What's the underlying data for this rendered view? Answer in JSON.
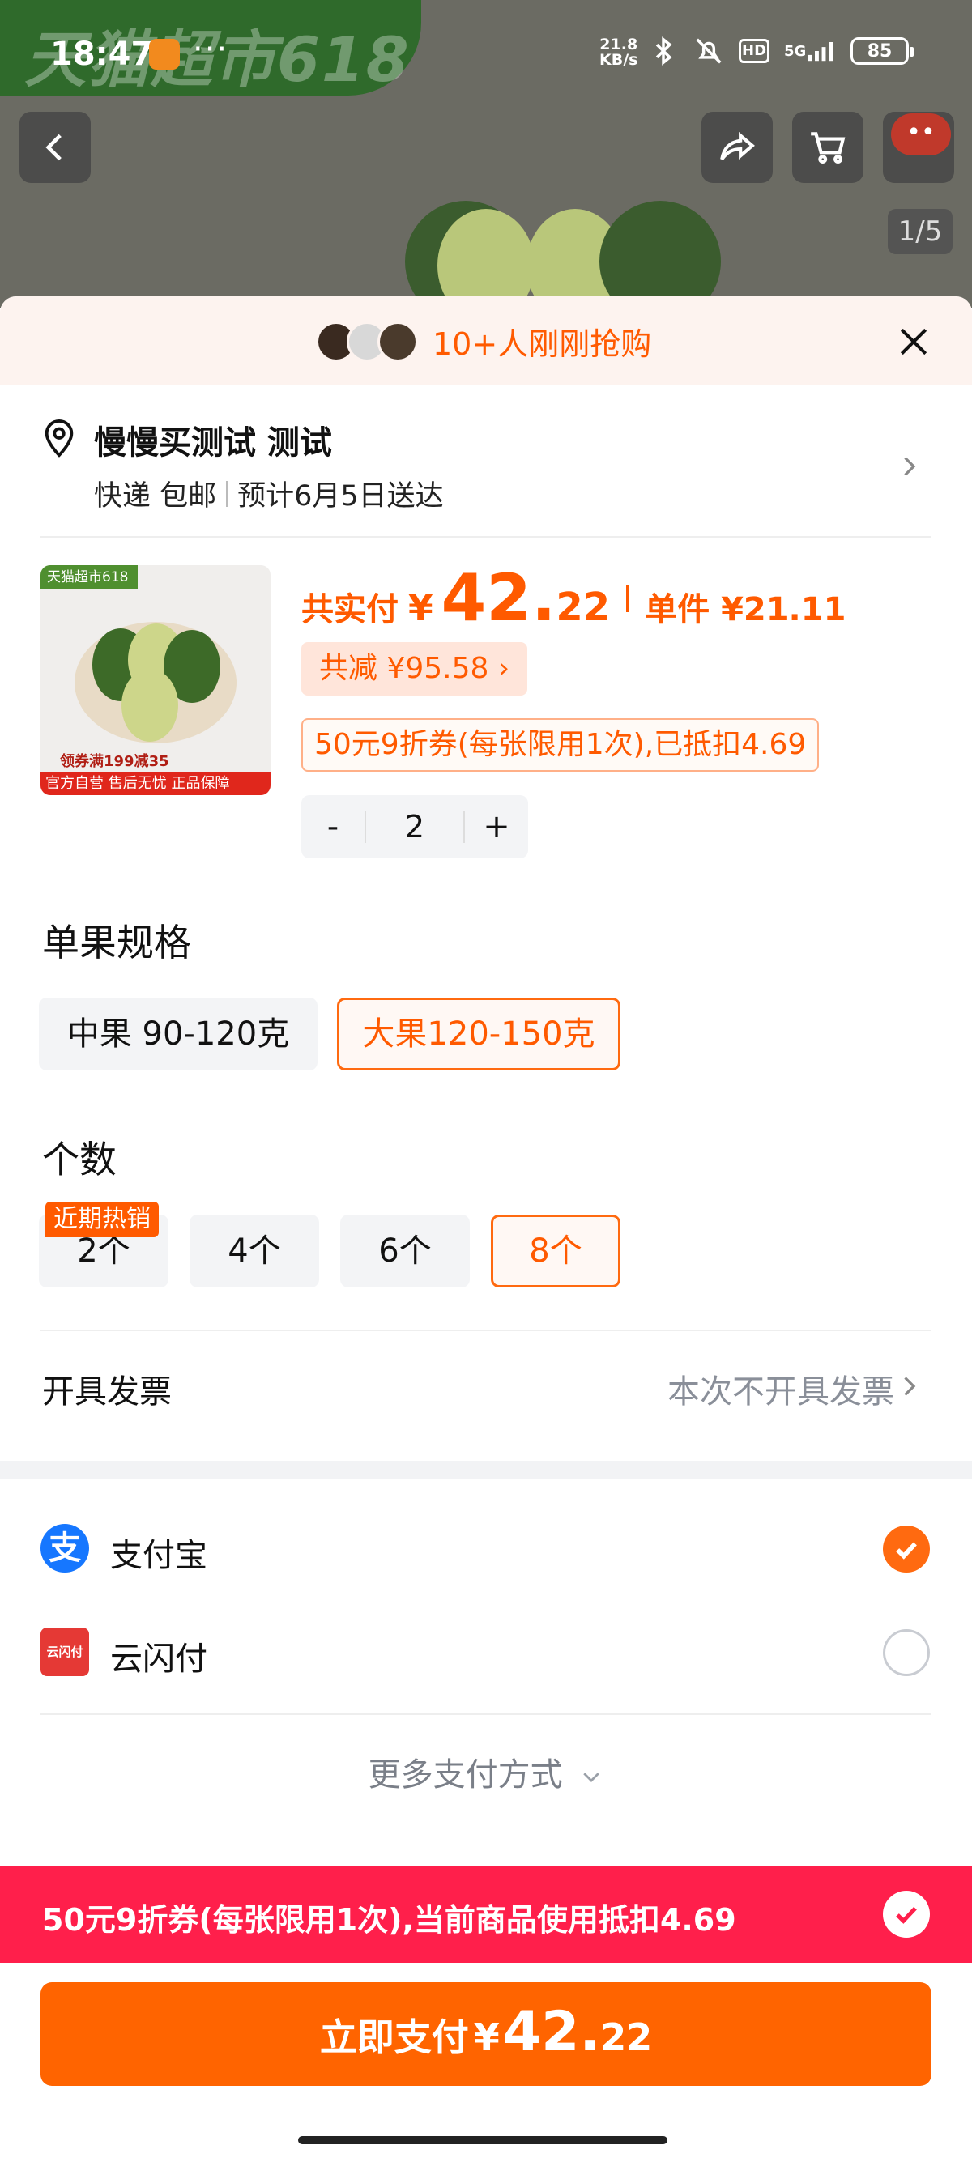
{
  "status_bar": {
    "time": "18:47",
    "dots": "···",
    "net_speed_value": "21.8",
    "net_speed_unit": "KB/s",
    "hd_badge": "HD",
    "signal_label": "5G",
    "battery_level": "85"
  },
  "top_banner": {
    "text": "天猫超市618"
  },
  "top_nav": {
    "cart_badge": "••",
    "image_counter": "1/5"
  },
  "buyers": {
    "text": "10+人刚刚抢购"
  },
  "address": {
    "name": "慢慢买测试 测试",
    "shipping": "快递 包邮",
    "delivery": "预计6月5日送达"
  },
  "product": {
    "image_tag": "天猫超市618",
    "image_coupon": "领券满199减35",
    "image_footer": "官方自营 售后无忧 正品保障",
    "price_label": "共实付",
    "price_yen": "¥",
    "price_int": "42.",
    "price_dec": "22",
    "unit_price": "单件 ¥21.11",
    "discount": "共减 ¥95.58 ›",
    "coupon": "50元9折券(每张限用1次),已抵扣4.69",
    "quantity": "2",
    "minus": "-",
    "plus": "+"
  },
  "spec": {
    "title": "单果规格",
    "options": [
      {
        "label": "中果 90-120克",
        "selected": false
      },
      {
        "label": "大果120-150克",
        "selected": true
      }
    ]
  },
  "count": {
    "title": "个数",
    "hot_badge": "近期热销",
    "options": [
      {
        "label": "2个",
        "selected": false
      },
      {
        "label": "4个",
        "selected": false
      },
      {
        "label": "6个",
        "selected": false
      },
      {
        "label": "8个",
        "selected": true
      }
    ]
  },
  "invoice": {
    "label": "开具发票",
    "value": "本次不开具发票"
  },
  "payment": {
    "methods": [
      {
        "name": "支付宝",
        "icon": "alipay-icon",
        "selected": true
      },
      {
        "name": "云闪付",
        "icon": "unionpay-icon",
        "selected": false
      }
    ],
    "alipay_glyph": "支",
    "union_glyph": "云闪付",
    "more": "更多支付方式"
  },
  "coupon_bar": {
    "text": "50元9折券(每张限用1次),当前商品使用抵扣4.69"
  },
  "pay_button": {
    "label": "立即支付",
    "yen": "¥",
    "int": "42.",
    "dec": "22"
  },
  "colors": {
    "accent": "#ff6400",
    "price": "#ff5a00",
    "coupon_bar": "#ff1f4b",
    "alipay": "#1677ff"
  }
}
